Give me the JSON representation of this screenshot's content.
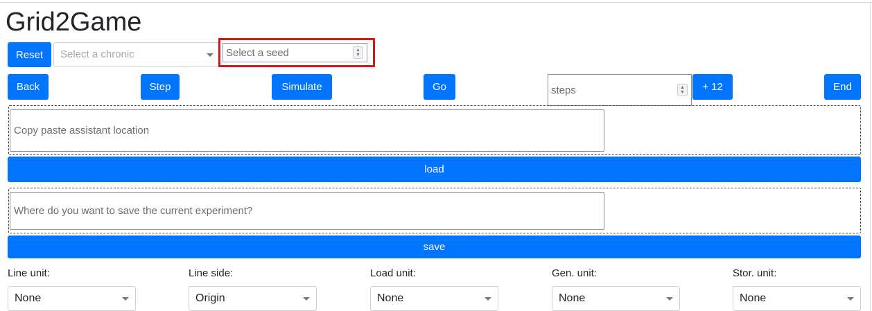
{
  "app": {
    "title": "Grid2Game"
  },
  "controls": {
    "reset_label": "Reset",
    "chronic_placeholder": "Select a chronic",
    "seed_placeholder": "Select a seed",
    "back_label": "Back",
    "step_label": "Step",
    "simulate_label": "Simulate",
    "go_label": "Go",
    "steps_placeholder": "steps",
    "plus_label": "+ 12",
    "end_label": "End"
  },
  "load_section": {
    "input_placeholder": "Copy paste assistant location",
    "button_label": "load"
  },
  "save_section": {
    "input_placeholder": "Where do you want to save the current experiment?",
    "button_label": "save"
  },
  "units": [
    {
      "label": "Line unit:",
      "value": "None"
    },
    {
      "label": "Line side:",
      "value": "Origin"
    },
    {
      "label": "Load unit:",
      "value": "None"
    },
    {
      "label": "Gen. unit:",
      "value": "None"
    },
    {
      "label": "Stor. unit:",
      "value": "None"
    }
  ],
  "colors": {
    "primary": "#0275ff",
    "highlight": "#e0101a"
  },
  "icons": [
    "chevron-down-icon",
    "spinner-arrows-icon"
  ]
}
